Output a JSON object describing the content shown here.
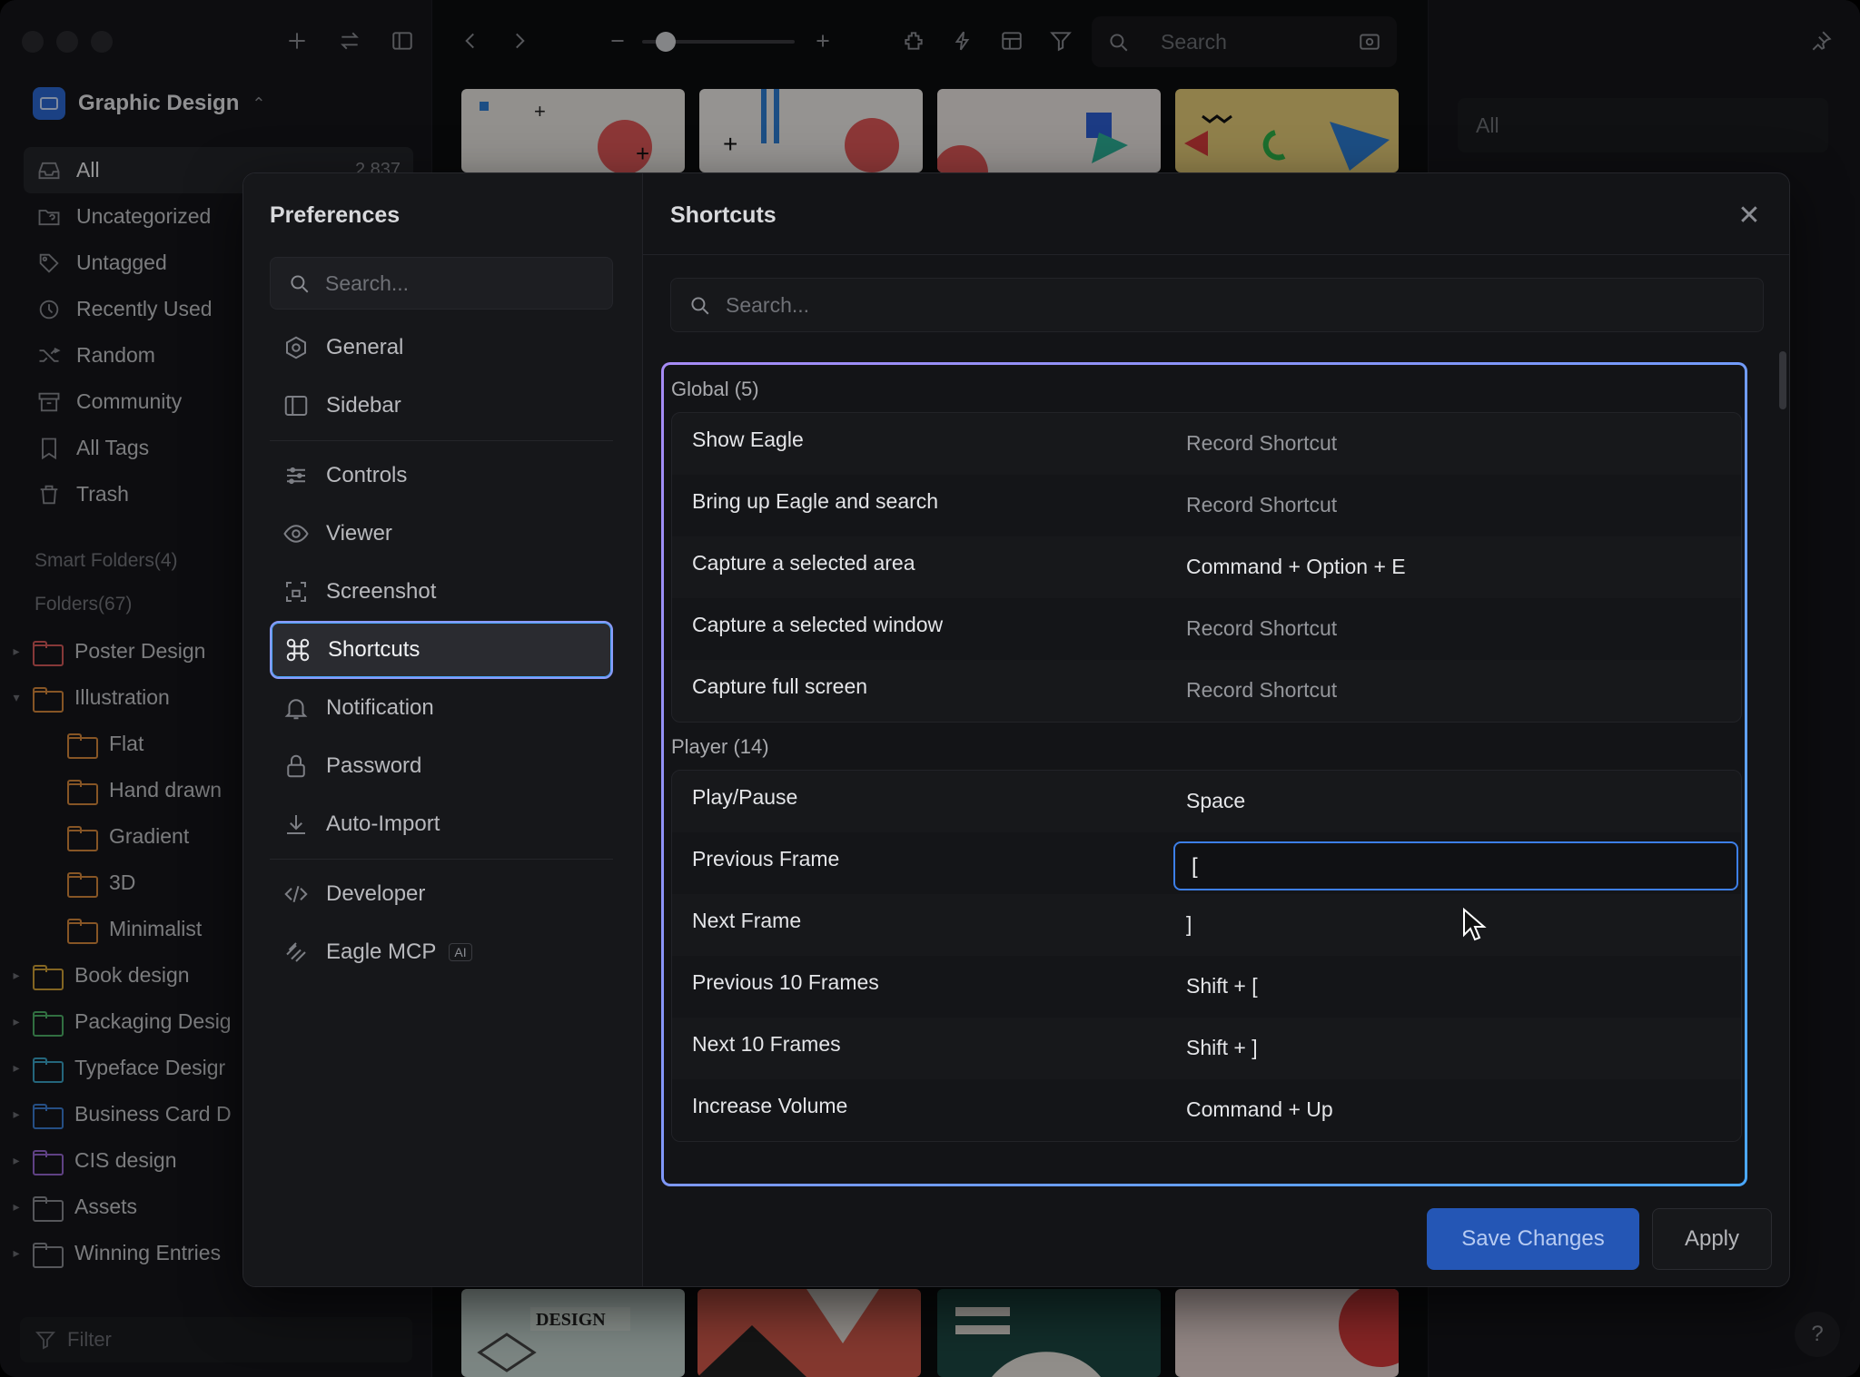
{
  "sidebar": {
    "library_name": "Graphic Design",
    "nav": [
      {
        "label": "All",
        "count": "2,837",
        "icon": "inbox-icon"
      },
      {
        "label": "Uncategorized",
        "icon": "folder-question-icon"
      },
      {
        "label": "Untagged",
        "icon": "tag-off-icon"
      },
      {
        "label": "Recently Used",
        "icon": "clock-icon"
      },
      {
        "label": "Random",
        "icon": "shuffle-icon"
      },
      {
        "label": "Community",
        "icon": "archive-icon"
      },
      {
        "label": "All Tags",
        "icon": "bookmark-icon"
      },
      {
        "label": "Trash",
        "icon": "trash-icon"
      }
    ],
    "smart_folders_label": "Smart Folders(4)",
    "folders_label": "Folders(67)",
    "folders": [
      {
        "label": "Poster Design",
        "color": "#d95b5b",
        "arrow": "▸",
        "child": false
      },
      {
        "label": "Illustration",
        "color": "#d98a3d",
        "arrow": "▾",
        "child": false
      },
      {
        "label": "Flat",
        "color": "#d98a3d",
        "arrow": "",
        "child": true
      },
      {
        "label": "Hand drawn",
        "color": "#d98a3d",
        "arrow": "",
        "child": true
      },
      {
        "label": "Gradient",
        "color": "#d98a3d",
        "arrow": "",
        "child": true
      },
      {
        "label": "3D",
        "color": "#d98a3d",
        "arrow": "",
        "child": true
      },
      {
        "label": "Minimalist",
        "color": "#d98a3d",
        "arrow": "",
        "child": true
      },
      {
        "label": "Book design",
        "color": "#d4a437",
        "arrow": "▸",
        "child": false
      },
      {
        "label": "Packaging Desig",
        "color": "#4fb36a",
        "arrow": "▸",
        "child": false
      },
      {
        "label": "Typeface Desigr",
        "color": "#3aa5c9",
        "arrow": "▸",
        "child": false
      },
      {
        "label": "Business Card D",
        "color": "#3d7fd6",
        "arrow": "▸",
        "child": false
      },
      {
        "label": "CIS design",
        "color": "#9a6ad6",
        "arrow": "▸",
        "child": false
      },
      {
        "label": "Assets",
        "color": "#8b8d93",
        "arrow": "▸",
        "child": false
      },
      {
        "label": "Winning Entries",
        "color": "#8b8d93",
        "arrow": "▸",
        "child": false
      }
    ],
    "filter_placeholder": "Filter"
  },
  "toolbar": {
    "search_placeholder": "Search",
    "zoom_level": 0.1
  },
  "right_panel": {
    "filter_value": "All"
  },
  "preferences": {
    "title": "Preferences",
    "search_placeholder": "Search...",
    "nav_group_1": [
      {
        "label": "General",
        "icon": "hexagon-gear-icon"
      },
      {
        "label": "Sidebar",
        "icon": "sidebar-icon"
      }
    ],
    "nav_group_2": [
      {
        "label": "Controls",
        "icon": "sliders-icon"
      },
      {
        "label": "Viewer",
        "icon": "eye-icon"
      },
      {
        "label": "Screenshot",
        "icon": "screenshot-icon"
      },
      {
        "label": "Shortcuts",
        "icon": "command-icon",
        "active": true
      },
      {
        "label": "Notification",
        "icon": "bell-icon"
      },
      {
        "label": "Password",
        "icon": "lock-icon"
      },
      {
        "label": "Auto-Import",
        "icon": "download-icon"
      }
    ],
    "nav_group_3": [
      {
        "label": "Developer",
        "icon": "code-icon"
      },
      {
        "label": "Eagle MCP",
        "icon": "mcp-icon",
        "badge": "AI"
      }
    ]
  },
  "shortcuts": {
    "title": "Shortcuts",
    "search_placeholder": "Search...",
    "groups": [
      {
        "title": "Global (5)",
        "rows": [
          {
            "label": "Show Eagle",
            "value": "Record Shortcut",
            "placeholder": true
          },
          {
            "label": "Bring up Eagle and search",
            "value": "Record Shortcut",
            "placeholder": true
          },
          {
            "label": "Capture a selected area",
            "value": "Command + Option + E",
            "placeholder": false
          },
          {
            "label": "Capture a selected window",
            "value": "Record Shortcut",
            "placeholder": true
          },
          {
            "label": "Capture full screen",
            "value": "Record Shortcut",
            "placeholder": true
          }
        ]
      },
      {
        "title": "Player (14)",
        "rows": [
          {
            "label": "Play/Pause",
            "value": "Space",
            "placeholder": false
          },
          {
            "label": "Previous Frame",
            "value": "[",
            "placeholder": false,
            "editing": true
          },
          {
            "label": "Next Frame",
            "value": "]",
            "placeholder": false
          },
          {
            "label": "Previous 10 Frames",
            "value": "Shift + [",
            "placeholder": false
          },
          {
            "label": "Next 10 Frames",
            "value": "Shift + ]",
            "placeholder": false
          },
          {
            "label": "Increase Volume",
            "value": "Command + Up",
            "placeholder": false
          }
        ]
      }
    ],
    "save_label": "Save Changes",
    "apply_label": "Apply"
  }
}
